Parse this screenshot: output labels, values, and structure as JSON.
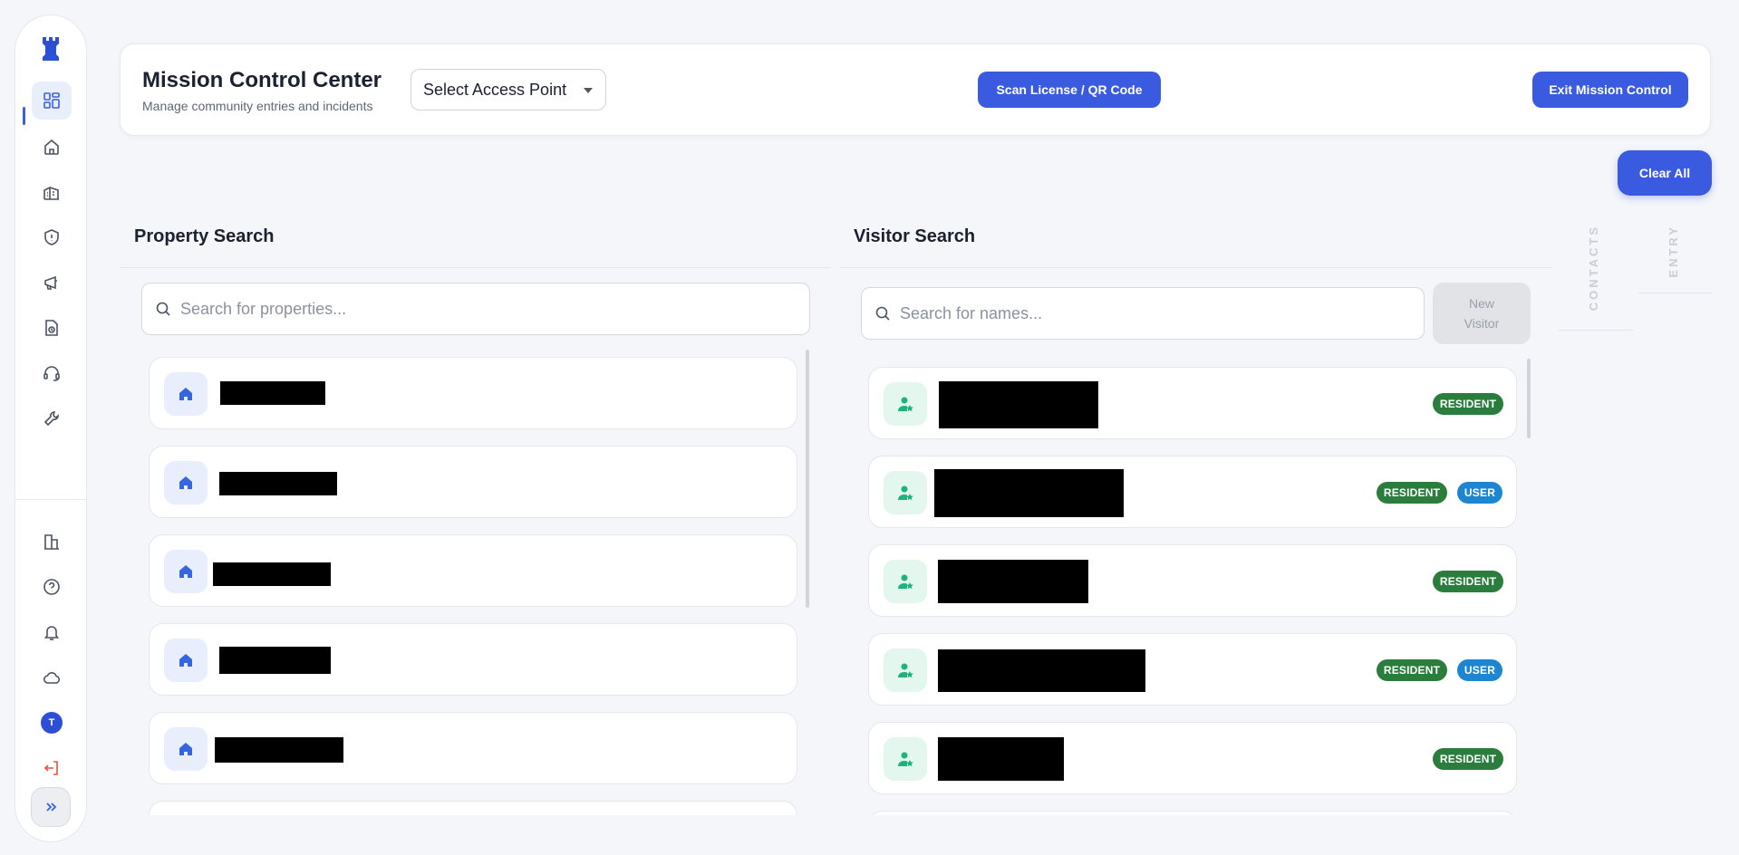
{
  "header": {
    "title": "Mission Control Center",
    "subtitle": "Manage community entries and incidents",
    "access_point": "Select Access Point",
    "scan_label": "Scan License / QR Code",
    "exit_label": "Exit Mission Control"
  },
  "clear_all_label": "Clear All",
  "sidebar": {
    "avatar_initial": "T",
    "nav_icons": [
      "dashboard-icon",
      "home-icon",
      "buildings-icon",
      "shield-icon",
      "megaphone-icon",
      "document-clock-icon",
      "headset-icon",
      "wrench-icon"
    ],
    "bottom_icons": [
      "chart-icon",
      "help-icon",
      "bell-icon",
      "cloud-icon",
      "avatar",
      "logout-icon"
    ]
  },
  "property_search": {
    "title": "Property Search",
    "placeholder": "Search for properties..."
  },
  "visitor_search": {
    "title": "Visitor Search",
    "placeholder": "Search for names...",
    "new_visitor_line1": "New",
    "new_visitor_line2": "Visitor",
    "visitors": [
      {
        "badges": [
          "RESIDENT"
        ]
      },
      {
        "badges": [
          "RESIDENT",
          "USER"
        ]
      },
      {
        "badges": [
          "RESIDENT"
        ]
      },
      {
        "badges": [
          "RESIDENT",
          "USER"
        ]
      },
      {
        "badges": [
          "RESIDENT"
        ]
      }
    ]
  },
  "side_tabs": {
    "contacts": "CONTACTS",
    "entry": "ENTRY"
  },
  "colors": {
    "primary": "#3a5be0",
    "resident_badge": "#2a7d3c",
    "user_badge": "#1e86d1",
    "logout_red": "#e0533f"
  }
}
